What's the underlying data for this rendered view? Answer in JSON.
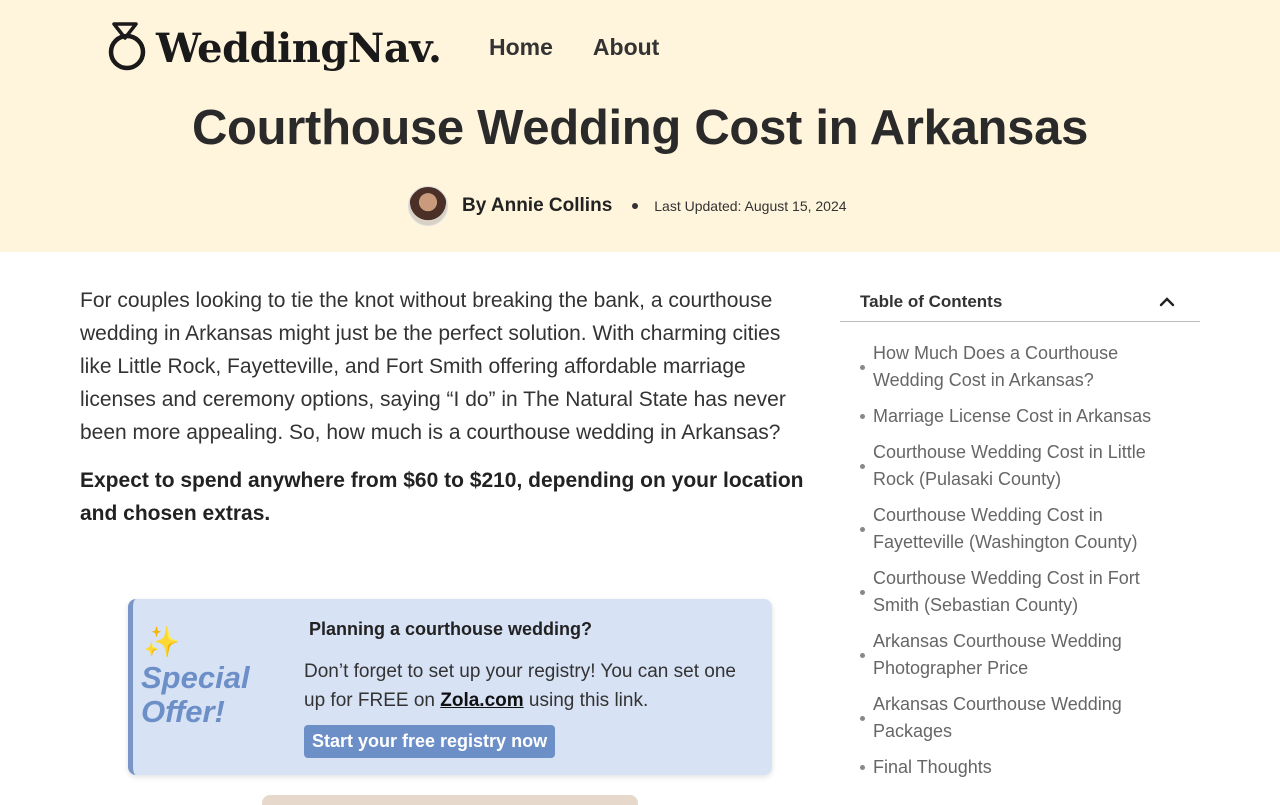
{
  "header": {
    "logo_text": "WeddingNav.",
    "nav": [
      {
        "label": "Home"
      },
      {
        "label": "About"
      }
    ]
  },
  "article": {
    "title": "Courthouse Wedding Cost in Arkansas",
    "author": "By Annie Collins",
    "updated": "Last Updated: August 15, 2024",
    "intro": "For couples looking to tie the knot without breaking the bank, a courthouse wedding in Arkansas might just be the perfect solution. With charming cities like Little Rock, Fayetteville, and Fort Smith offering affordable marriage licenses and ceremony options, saying “I do” in The Natural State has never been more appealing. So, how much is a courthouse wedding in Arkansas?",
    "lead": "Expect to spend anywhere from $60 to $210, depending on your location and chosen extras."
  },
  "offer": {
    "sparkle": "✨",
    "badge": "Special Offer!",
    "title": "Planning a courthouse wedding?",
    "body_before": "Don’t forget to set up your registry! You can set one up for FREE on ",
    "link": "Zola.com",
    "body_after": " using this link.",
    "cta": "Start your free registry now"
  },
  "toc": {
    "title": "Table of Contents",
    "items": [
      {
        "label": "How Much Does a Courthouse Wedding Cost in Arkansas?"
      },
      {
        "label": "Marriage License Cost in Arkansas"
      },
      {
        "label": "Courthouse Wedding Cost in Little Rock (Pulasaki County)"
      },
      {
        "label": "Courthouse Wedding Cost in Fayetteville (Washington County)"
      },
      {
        "label": "Courthouse Wedding Cost in Fort Smith (Sebastian County)"
      },
      {
        "label": "Arkansas Courthouse Wedding Photographer Price"
      },
      {
        "label": "Arkansas Courthouse Wedding Packages"
      },
      {
        "label": "Final Thoughts"
      }
    ]
  },
  "colors": {
    "hero_bg": "#fff4dc",
    "offer_bg": "#d7e2f5",
    "accent": "#6d8fc8",
    "sparkle": "#f2b322"
  },
  "icons": {
    "logo": "ring-icon",
    "toc_toggle": "chevron-up-icon",
    "author": "avatar"
  }
}
